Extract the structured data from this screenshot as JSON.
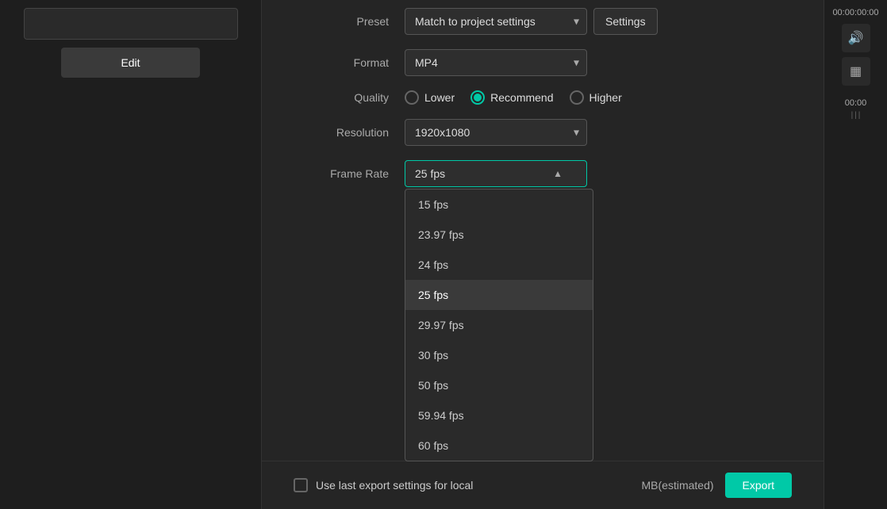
{
  "leftPanel": {
    "editButton": "Edit"
  },
  "mainPanel": {
    "preset": {
      "label": "Preset",
      "value": "Match to project settings",
      "settingsButton": "Settings"
    },
    "format": {
      "label": "Format",
      "value": "MP4"
    },
    "quality": {
      "label": "Quality",
      "options": [
        {
          "id": "lower",
          "label": "Lower",
          "selected": false
        },
        {
          "id": "recommend",
          "label": "Recommend",
          "selected": true
        },
        {
          "id": "higher",
          "label": "Higher",
          "selected": false
        }
      ]
    },
    "resolution": {
      "label": "Resolution",
      "value": "1920x1080"
    },
    "frameRate": {
      "label": "Frame Rate",
      "value": "25 fps",
      "isOpen": true,
      "options": [
        {
          "value": "15 fps",
          "active": false
        },
        {
          "value": "23.97 fps",
          "active": false
        },
        {
          "value": "24 fps",
          "active": false
        },
        {
          "value": "25 fps",
          "active": true
        },
        {
          "value": "29.97 fps",
          "active": false
        },
        {
          "value": "30 fps",
          "active": false
        },
        {
          "value": "50 fps",
          "active": false
        },
        {
          "value": "59.94 fps",
          "active": false
        },
        {
          "value": "60 fps",
          "active": false
        }
      ]
    },
    "toggle1": {
      "on": false
    },
    "toggle2": {
      "on": true
    }
  },
  "bottomBar": {
    "checkboxLabel": "Use last export settings for local",
    "estimatedSize": "MB(estimated)",
    "exportButton": "Export"
  },
  "rightPanel": {
    "time1": "00:00:00:00",
    "time2": "00:00",
    "volumeIcon": "🔊",
    "gridIcon": "▦"
  }
}
